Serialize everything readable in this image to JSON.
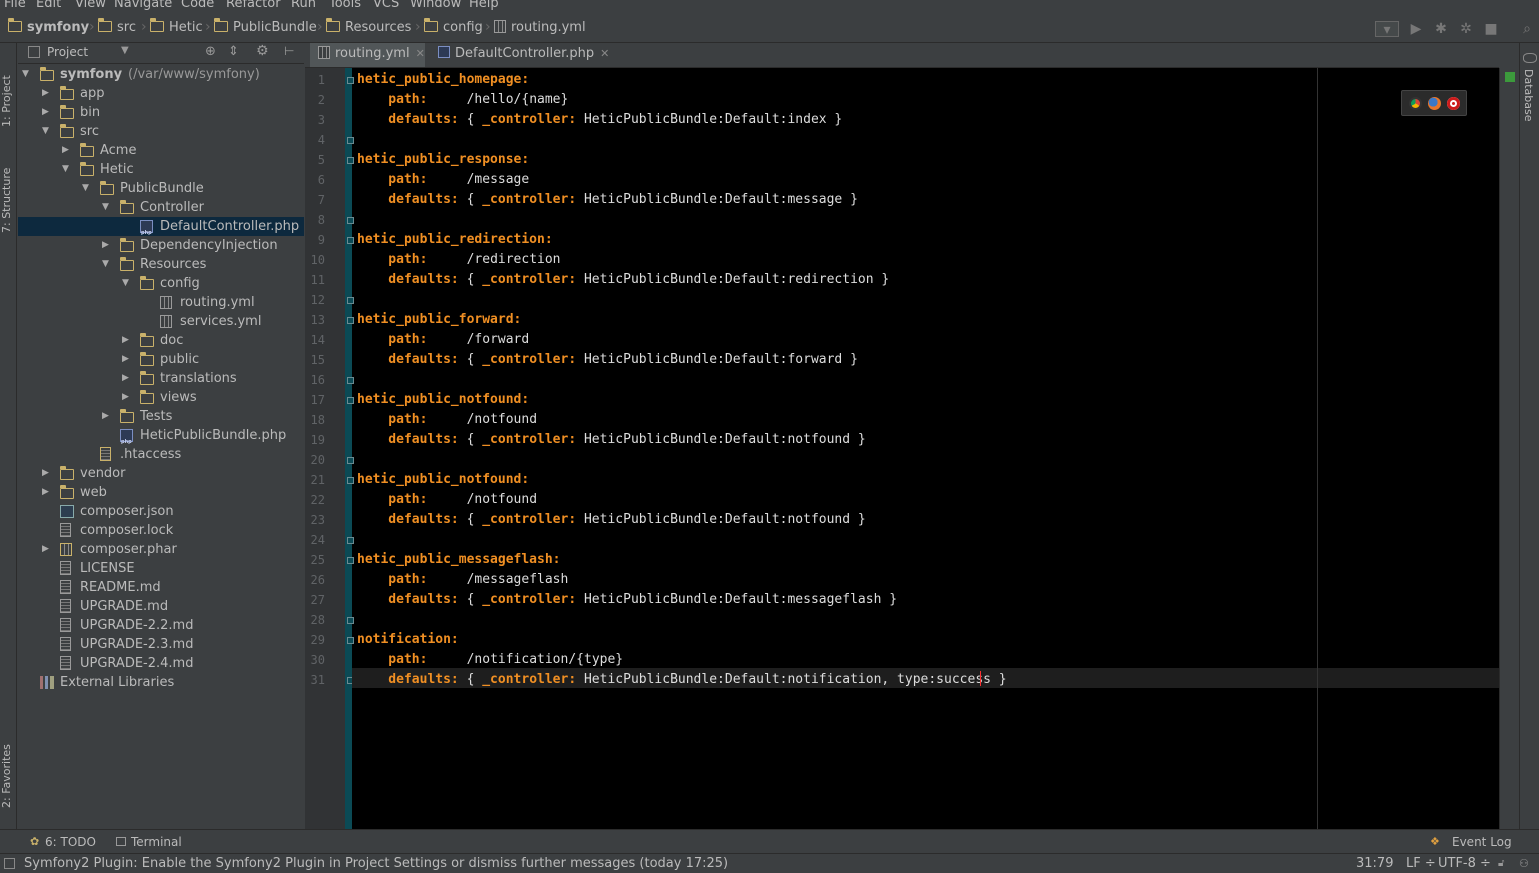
{
  "menu": [
    "File",
    "Edit",
    "View",
    "Navigate",
    "Code",
    "Refactor",
    "Run",
    "Tools",
    "VCS",
    "Window",
    "Help"
  ],
  "breadcrumbs": [
    "symfony",
    "src",
    "Hetic",
    "PublicBundle",
    "Resources",
    "config",
    "routing.yml"
  ],
  "side_left": {
    "project": "1: Project",
    "structure": "7: Structure",
    "favorites": "2: Favorites"
  },
  "side_right": {
    "database": "Database"
  },
  "project_panel": {
    "title": "Project"
  },
  "tree": [
    {
      "label": "symfony",
      "extra": "(/var/www/symfony)",
      "depth": 0,
      "arrow": "down",
      "icon": "folder",
      "bold": true
    },
    {
      "label": "app",
      "depth": 1,
      "arrow": "right",
      "icon": "folder"
    },
    {
      "label": "bin",
      "depth": 1,
      "arrow": "right",
      "icon": "folder"
    },
    {
      "label": "src",
      "depth": 1,
      "arrow": "down",
      "icon": "folder"
    },
    {
      "label": "Acme",
      "depth": 2,
      "arrow": "right",
      "icon": "folder"
    },
    {
      "label": "Hetic",
      "depth": 2,
      "arrow": "down",
      "icon": "folder"
    },
    {
      "label": "PublicBundle",
      "depth": 3,
      "arrow": "down",
      "icon": "folder"
    },
    {
      "label": "Controller",
      "depth": 4,
      "arrow": "down",
      "icon": "folder"
    },
    {
      "label": "DefaultController.php",
      "depth": 5,
      "arrow": "",
      "icon": "php",
      "selected": true
    },
    {
      "label": "DependencyInjection",
      "depth": 4,
      "arrow": "right",
      "icon": "folder"
    },
    {
      "label": "Resources",
      "depth": 4,
      "arrow": "down",
      "icon": "folder"
    },
    {
      "label": "config",
      "depth": 5,
      "arrow": "down",
      "icon": "folder"
    },
    {
      "label": "routing.yml",
      "depth": 6,
      "arrow": "",
      "icon": "grid"
    },
    {
      "label": "services.yml",
      "depth": 6,
      "arrow": "",
      "icon": "grid"
    },
    {
      "label": "doc",
      "depth": 5,
      "arrow": "right",
      "icon": "folder"
    },
    {
      "label": "public",
      "depth": 5,
      "arrow": "right",
      "icon": "folder"
    },
    {
      "label": "translations",
      "depth": 5,
      "arrow": "right",
      "icon": "folder"
    },
    {
      "label": "views",
      "depth": 5,
      "arrow": "right",
      "icon": "folder"
    },
    {
      "label": "Tests",
      "depth": 4,
      "arrow": "right",
      "icon": "folder"
    },
    {
      "label": "HeticPublicBundle.php",
      "depth": 4,
      "arrow": "",
      "icon": "php"
    },
    {
      "label": ".htaccess",
      "depth": 3,
      "arrow": "",
      "icon": "htaccess"
    },
    {
      "label": "vendor",
      "depth": 1,
      "arrow": "right",
      "icon": "folder"
    },
    {
      "label": "web",
      "depth": 1,
      "arrow": "right",
      "icon": "folder"
    },
    {
      "label": "composer.json",
      "depth": 1,
      "arrow": "",
      "icon": "json"
    },
    {
      "label": "composer.lock",
      "depth": 1,
      "arrow": "",
      "icon": "text"
    },
    {
      "label": "composer.phar",
      "depth": 1,
      "arrow": "right",
      "icon": "phar"
    },
    {
      "label": "LICENSE",
      "depth": 1,
      "arrow": "",
      "icon": "text"
    },
    {
      "label": "README.md",
      "depth": 1,
      "arrow": "",
      "icon": "text"
    },
    {
      "label": "UPGRADE.md",
      "depth": 1,
      "arrow": "",
      "icon": "text"
    },
    {
      "label": "UPGRADE-2.2.md",
      "depth": 1,
      "arrow": "",
      "icon": "text"
    },
    {
      "label": "UPGRADE-2.3.md",
      "depth": 1,
      "arrow": "",
      "icon": "text"
    },
    {
      "label": "UPGRADE-2.4.md",
      "depth": 1,
      "arrow": "",
      "icon": "text"
    },
    {
      "label": "External Libraries",
      "depth": 0,
      "arrow": "",
      "icon": "lib"
    }
  ],
  "tabs": [
    {
      "label": "routing.yml",
      "active": true
    },
    {
      "label": "DefaultController.php",
      "active": false
    }
  ],
  "code_lines": [
    {
      "n": "1",
      "key": "hetic_public_homepage:",
      "val": ""
    },
    {
      "n": "2",
      "key": "    path:",
      "val": "     /hello/{name}"
    },
    {
      "n": "3",
      "key": "    defaults:",
      "val": " { ",
      "key2": "_controller:",
      "val2": " HeticPublicBundle:Default:index }"
    },
    {
      "n": "4",
      "key": "",
      "val": ""
    },
    {
      "n": "5",
      "key": "hetic_public_response:",
      "val": ""
    },
    {
      "n": "6",
      "key": "    path:",
      "val": "     /message"
    },
    {
      "n": "7",
      "key": "    defaults:",
      "val": " { ",
      "key2": "_controller:",
      "val2": " HeticPublicBundle:Default:message }"
    },
    {
      "n": "8",
      "key": "",
      "val": ""
    },
    {
      "n": "9",
      "key": "hetic_public_redirection:",
      "val": ""
    },
    {
      "n": "10",
      "key": "    path:",
      "val": "     /redirection"
    },
    {
      "n": "11",
      "key": "    defaults:",
      "val": " { ",
      "key2": "_controller:",
      "val2": " HeticPublicBundle:Default:redirection }"
    },
    {
      "n": "12",
      "key": "",
      "val": ""
    },
    {
      "n": "13",
      "key": "hetic_public_forward:",
      "val": ""
    },
    {
      "n": "14",
      "key": "    path:",
      "val": "     /forward"
    },
    {
      "n": "15",
      "key": "    defaults:",
      "val": " { ",
      "key2": "_controller:",
      "val2": " HeticPublicBundle:Default:forward }"
    },
    {
      "n": "16",
      "key": "",
      "val": ""
    },
    {
      "n": "17",
      "key": "hetic_public_notfound:",
      "val": ""
    },
    {
      "n": "18",
      "key": "    path:",
      "val": "     /notfound"
    },
    {
      "n": "19",
      "key": "    defaults:",
      "val": " { ",
      "key2": "_controller:",
      "val2": " HeticPublicBundle:Default:notfound }"
    },
    {
      "n": "20",
      "key": "",
      "val": ""
    },
    {
      "n": "21",
      "key": "hetic_public_notfound:",
      "val": ""
    },
    {
      "n": "22",
      "key": "    path:",
      "val": "     /notfound"
    },
    {
      "n": "23",
      "key": "    defaults:",
      "val": " { ",
      "key2": "_controller:",
      "val2": " HeticPublicBundle:Default:notfound }"
    },
    {
      "n": "24",
      "key": "",
      "val": ""
    },
    {
      "n": "25",
      "key": "hetic_public_messageflash:",
      "val": ""
    },
    {
      "n": "26",
      "key": "    path:",
      "val": "     /messageflash"
    },
    {
      "n": "27",
      "key": "    defaults:",
      "val": " { ",
      "key2": "_controller:",
      "val2": " HeticPublicBundle:Default:messageflash }"
    },
    {
      "n": "28",
      "key": "",
      "val": ""
    },
    {
      "n": "29",
      "key": "notification:",
      "val": ""
    },
    {
      "n": "30",
      "key": "    path:",
      "val": "     /notification/{type}"
    },
    {
      "n": "31",
      "key": "    defaults:",
      "val": " { ",
      "key2": "_controller:",
      "val2": " HeticPublicBundle:Default:notification, type:success }"
    }
  ],
  "bottom_tools": {
    "todo": "6: TODO",
    "terminal": "Terminal",
    "event_log": "Event Log"
  },
  "status": {
    "message": "Symfony2 Plugin: Enable the Symfony2 Plugin in Project Settings or dismiss further messages (today 17:25)",
    "position": "31:79",
    "line_sep": "LF ÷",
    "encoding": "UTF-8 ÷"
  },
  "colors": {
    "keyword": "#f08f23",
    "text": "#dddddd",
    "background": "#000000",
    "fold_column": "#0b4a55",
    "selection": "#0d293e"
  }
}
